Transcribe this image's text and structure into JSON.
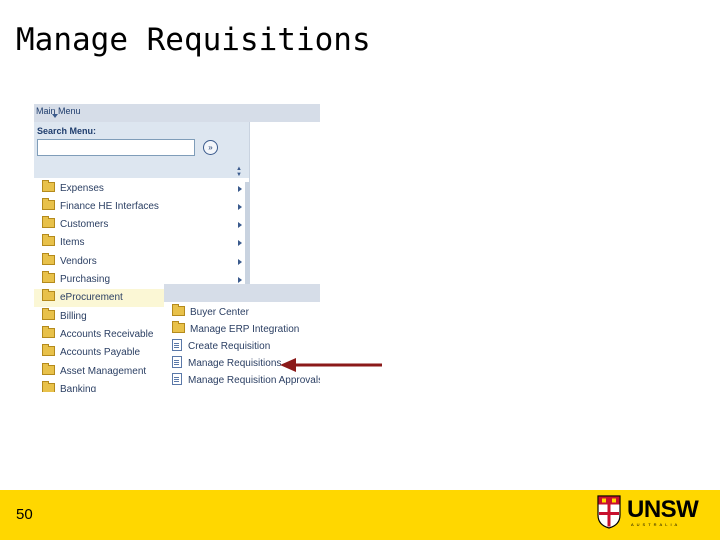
{
  "slide": {
    "title": "Manage Requisitions",
    "page_number": "50"
  },
  "menu": {
    "main_menu_label": "Main Menu",
    "search_label": "Search Menu:",
    "search_value": "",
    "search_go_glyph": "»",
    "items": [
      {
        "label": "Expenses",
        "has_submenu": true
      },
      {
        "label": "Finance HE Interfaces",
        "has_submenu": true
      },
      {
        "label": "Customers",
        "has_submenu": true
      },
      {
        "label": "Items",
        "has_submenu": true
      },
      {
        "label": "Vendors",
        "has_submenu": true
      },
      {
        "label": "Purchasing",
        "has_submenu": true
      },
      {
        "label": "eProcurement",
        "has_submenu": true,
        "highlighted": true
      },
      {
        "label": "Billing"
      },
      {
        "label": "Accounts Receivable"
      },
      {
        "label": "Accounts Payable"
      },
      {
        "label": "Asset Management"
      },
      {
        "label": "Banking"
      }
    ],
    "submenu": [
      {
        "label": "Buyer Center",
        "icon": "folder-icon"
      },
      {
        "label": "Manage ERP Integration",
        "icon": "folder-icon"
      },
      {
        "label": "Create Requisition",
        "icon": "document-icon"
      },
      {
        "label": "Manage Requisitions",
        "icon": "document-icon"
      },
      {
        "label": "Manage Requisition Approvals",
        "icon": "document-icon"
      }
    ]
  },
  "branding": {
    "logo_text": "UNSW",
    "logo_subtext": "AUSTRALIA"
  },
  "colors": {
    "footer": "#ffd700",
    "arrow": "#8b1a1a",
    "menu_text": "#2b3f63"
  }
}
